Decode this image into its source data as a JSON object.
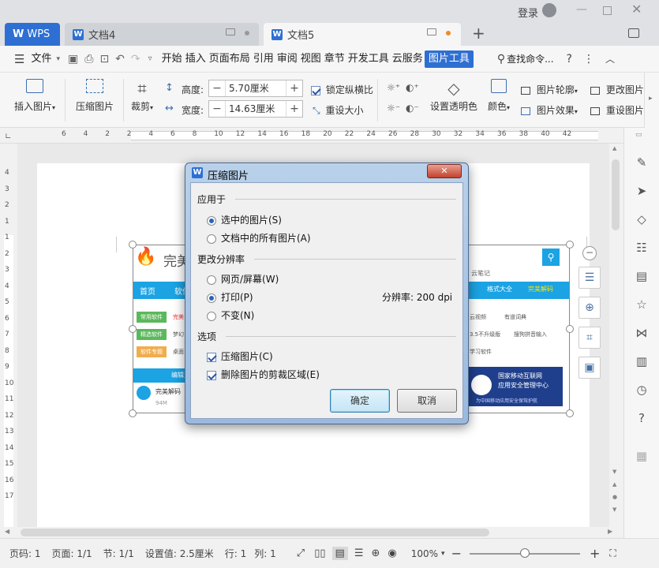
{
  "titlebar": {
    "login": "登录",
    "tabs": [
      {
        "label": "WPS"
      },
      {
        "label": "文档4"
      },
      {
        "label": "文档5"
      }
    ],
    "new_tab": "+"
  },
  "menubar": {
    "file": "文件",
    "items": [
      "开始",
      "插入",
      "页面布局",
      "引用",
      "审阅",
      "视图",
      "章节",
      "开发工具",
      "云服务",
      "图片工具"
    ],
    "search": "查找命令..."
  },
  "ribbon": {
    "insert_picture": "插入图片",
    "compress": "压缩图片",
    "crop": "裁剪",
    "height_label": "高度:",
    "height_value": "5.70厘米",
    "width_label": "宽度:",
    "width_value": "14.63厘米",
    "lock_ratio": "锁定纵横比",
    "reset_size": "重设大小",
    "transparency": "设置透明色",
    "color": "颜色",
    "outline": "图片轮廓",
    "effect": "图片效果",
    "change_picture": "更改图片",
    "reset_picture": "重设图片"
  },
  "ruler": {
    "h_ticks": [
      "6",
      "4",
      "2",
      "2",
      "4",
      "6",
      "8",
      "10",
      "12",
      "14",
      "16",
      "18",
      "20",
      "22",
      "24",
      "26",
      "28",
      "30",
      "32",
      "34",
      "36",
      "38",
      "40",
      "42"
    ],
    "v_ticks": [
      "4",
      "3",
      "2",
      "1",
      "1",
      "2",
      "3",
      "4",
      "5",
      "6",
      "7",
      "8",
      "9",
      "10",
      "11",
      "12",
      "13",
      "14",
      "15",
      "16",
      "17"
    ]
  },
  "doc_image": {
    "logo_text": "完美",
    "nav_home": "首页",
    "nav_item": "软件",
    "nav_right1": "格式大全",
    "nav_right2": "完美解码",
    "side_btns": [
      "常用软件",
      "精选软件",
      "软件专题"
    ],
    "side_btn_text": [
      "完美",
      "梦幻",
      "桌面"
    ],
    "right_links": [
      "云视频",
      "有道词典",
      "3.5不升级版",
      "搜狗拼音输入",
      "学习软件"
    ],
    "top_right": "云笔记",
    "bottom_tab": "编辑选",
    "item_name": "完美解码",
    "item_size": "94M",
    "ad_title1": "国家移动互联网",
    "ad_title2": "应用安全管理中心",
    "ad_sub": "为中国移动应用安全保驾护航"
  },
  "dialog": {
    "title": "压缩图片",
    "apply_to": "应用于",
    "opt_selected": "选中的图片(S)",
    "opt_all": "文档中的所有图片(A)",
    "change_res": "更改分辨率",
    "opt_web": "网页/屏幕(W)",
    "opt_print": "打印(P)",
    "resolution": "分辨率: 200 dpi",
    "opt_none": "不变(N)",
    "options": "选项",
    "chk_compress": "压缩图片(C)",
    "chk_delete_crop": "删除图片的剪裁区域(E)",
    "ok": "确定",
    "cancel": "取消"
  },
  "status": {
    "page": "页码: 1",
    "pages": "页面: 1/1",
    "section": "节: 1/1",
    "setting": "设置值: 2.5厘米",
    "row": "行: 1",
    "col": "列: 1",
    "zoom": "100%",
    "zoom_level": 0.5
  },
  "colors": {
    "accent": "#2e6fd3",
    "nav_blue": "#1ba3e3"
  }
}
